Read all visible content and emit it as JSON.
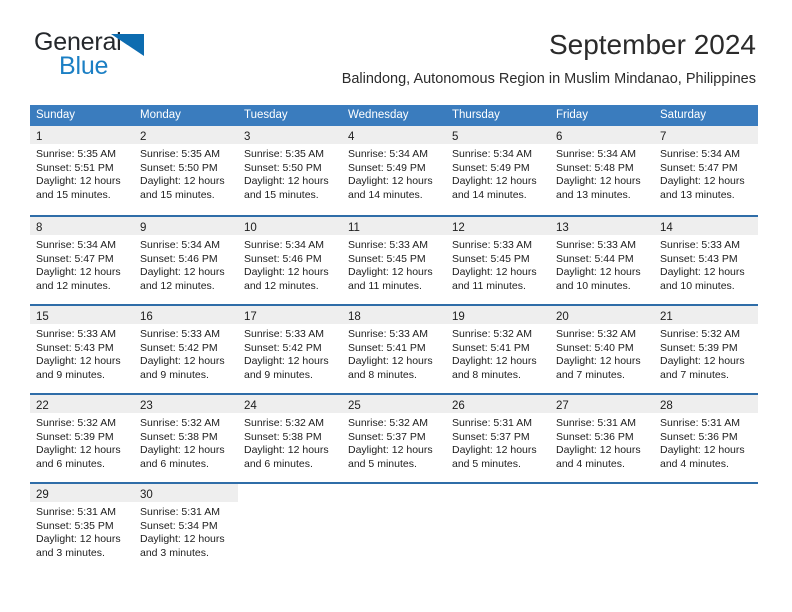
{
  "brand": {
    "word_one": "General",
    "word_two": "Blue",
    "flag_icon": "triangle-flag-icon",
    "blue": "#1b7fc4"
  },
  "header": {
    "title": "September 2024",
    "subtitle": "Balindong, Autonomous Region in Muslim Mindanao, Philippines"
  },
  "theme": {
    "header_blue": "#3a7cbe",
    "row_divider_blue": "#2f6da8",
    "daynum_band": "#eeeeee"
  },
  "weekdays": [
    "Sunday",
    "Monday",
    "Tuesday",
    "Wednesday",
    "Thursday",
    "Friday",
    "Saturday"
  ],
  "weeks": [
    [
      {
        "day": "1",
        "lines": [
          "Sunrise: 5:35 AM",
          "Sunset: 5:51 PM",
          "Daylight: 12 hours",
          "and 15 minutes."
        ]
      },
      {
        "day": "2",
        "lines": [
          "Sunrise: 5:35 AM",
          "Sunset: 5:50 PM",
          "Daylight: 12 hours",
          "and 15 minutes."
        ]
      },
      {
        "day": "3",
        "lines": [
          "Sunrise: 5:35 AM",
          "Sunset: 5:50 PM",
          "Daylight: 12 hours",
          "and 15 minutes."
        ]
      },
      {
        "day": "4",
        "lines": [
          "Sunrise: 5:34 AM",
          "Sunset: 5:49 PM",
          "Daylight: 12 hours",
          "and 14 minutes."
        ]
      },
      {
        "day": "5",
        "lines": [
          "Sunrise: 5:34 AM",
          "Sunset: 5:49 PM",
          "Daylight: 12 hours",
          "and 14 minutes."
        ]
      },
      {
        "day": "6",
        "lines": [
          "Sunrise: 5:34 AM",
          "Sunset: 5:48 PM",
          "Daylight: 12 hours",
          "and 13 minutes."
        ]
      },
      {
        "day": "7",
        "lines": [
          "Sunrise: 5:34 AM",
          "Sunset: 5:47 PM",
          "Daylight: 12 hours",
          "and 13 minutes."
        ]
      }
    ],
    [
      {
        "day": "8",
        "lines": [
          "Sunrise: 5:34 AM",
          "Sunset: 5:47 PM",
          "Daylight: 12 hours",
          "and 12 minutes."
        ]
      },
      {
        "day": "9",
        "lines": [
          "Sunrise: 5:34 AM",
          "Sunset: 5:46 PM",
          "Daylight: 12 hours",
          "and 12 minutes."
        ]
      },
      {
        "day": "10",
        "lines": [
          "Sunrise: 5:34 AM",
          "Sunset: 5:46 PM",
          "Daylight: 12 hours",
          "and 12 minutes."
        ]
      },
      {
        "day": "11",
        "lines": [
          "Sunrise: 5:33 AM",
          "Sunset: 5:45 PM",
          "Daylight: 12 hours",
          "and 11 minutes."
        ]
      },
      {
        "day": "12",
        "lines": [
          "Sunrise: 5:33 AM",
          "Sunset: 5:45 PM",
          "Daylight: 12 hours",
          "and 11 minutes."
        ]
      },
      {
        "day": "13",
        "lines": [
          "Sunrise: 5:33 AM",
          "Sunset: 5:44 PM",
          "Daylight: 12 hours",
          "and 10 minutes."
        ]
      },
      {
        "day": "14",
        "lines": [
          "Sunrise: 5:33 AM",
          "Sunset: 5:43 PM",
          "Daylight: 12 hours",
          "and 10 minutes."
        ]
      }
    ],
    [
      {
        "day": "15",
        "lines": [
          "Sunrise: 5:33 AM",
          "Sunset: 5:43 PM",
          "Daylight: 12 hours",
          "and 9 minutes."
        ]
      },
      {
        "day": "16",
        "lines": [
          "Sunrise: 5:33 AM",
          "Sunset: 5:42 PM",
          "Daylight: 12 hours",
          "and 9 minutes."
        ]
      },
      {
        "day": "17",
        "lines": [
          "Sunrise: 5:33 AM",
          "Sunset: 5:42 PM",
          "Daylight: 12 hours",
          "and 9 minutes."
        ]
      },
      {
        "day": "18",
        "lines": [
          "Sunrise: 5:33 AM",
          "Sunset: 5:41 PM",
          "Daylight: 12 hours",
          "and 8 minutes."
        ]
      },
      {
        "day": "19",
        "lines": [
          "Sunrise: 5:32 AM",
          "Sunset: 5:41 PM",
          "Daylight: 12 hours",
          "and 8 minutes."
        ]
      },
      {
        "day": "20",
        "lines": [
          "Sunrise: 5:32 AM",
          "Sunset: 5:40 PM",
          "Daylight: 12 hours",
          "and 7 minutes."
        ]
      },
      {
        "day": "21",
        "lines": [
          "Sunrise: 5:32 AM",
          "Sunset: 5:39 PM",
          "Daylight: 12 hours",
          "and 7 minutes."
        ]
      }
    ],
    [
      {
        "day": "22",
        "lines": [
          "Sunrise: 5:32 AM",
          "Sunset: 5:39 PM",
          "Daylight: 12 hours",
          "and 6 minutes."
        ]
      },
      {
        "day": "23",
        "lines": [
          "Sunrise: 5:32 AM",
          "Sunset: 5:38 PM",
          "Daylight: 12 hours",
          "and 6 minutes."
        ]
      },
      {
        "day": "24",
        "lines": [
          "Sunrise: 5:32 AM",
          "Sunset: 5:38 PM",
          "Daylight: 12 hours",
          "and 6 minutes."
        ]
      },
      {
        "day": "25",
        "lines": [
          "Sunrise: 5:32 AM",
          "Sunset: 5:37 PM",
          "Daylight: 12 hours",
          "and 5 minutes."
        ]
      },
      {
        "day": "26",
        "lines": [
          "Sunrise: 5:31 AM",
          "Sunset: 5:37 PM",
          "Daylight: 12 hours",
          "and 5 minutes."
        ]
      },
      {
        "day": "27",
        "lines": [
          "Sunrise: 5:31 AM",
          "Sunset: 5:36 PM",
          "Daylight: 12 hours",
          "and 4 minutes."
        ]
      },
      {
        "day": "28",
        "lines": [
          "Sunrise: 5:31 AM",
          "Sunset: 5:36 PM",
          "Daylight: 12 hours",
          "and 4 minutes."
        ]
      }
    ],
    [
      {
        "day": "29",
        "lines": [
          "Sunrise: 5:31 AM",
          "Sunset: 5:35 PM",
          "Daylight: 12 hours",
          "and 3 minutes."
        ]
      },
      {
        "day": "30",
        "lines": [
          "Sunrise: 5:31 AM",
          "Sunset: 5:34 PM",
          "Daylight: 12 hours",
          "and 3 minutes."
        ]
      },
      {
        "day": "",
        "lines": []
      },
      {
        "day": "",
        "lines": []
      },
      {
        "day": "",
        "lines": []
      },
      {
        "day": "",
        "lines": []
      },
      {
        "day": "",
        "lines": []
      }
    ]
  ]
}
